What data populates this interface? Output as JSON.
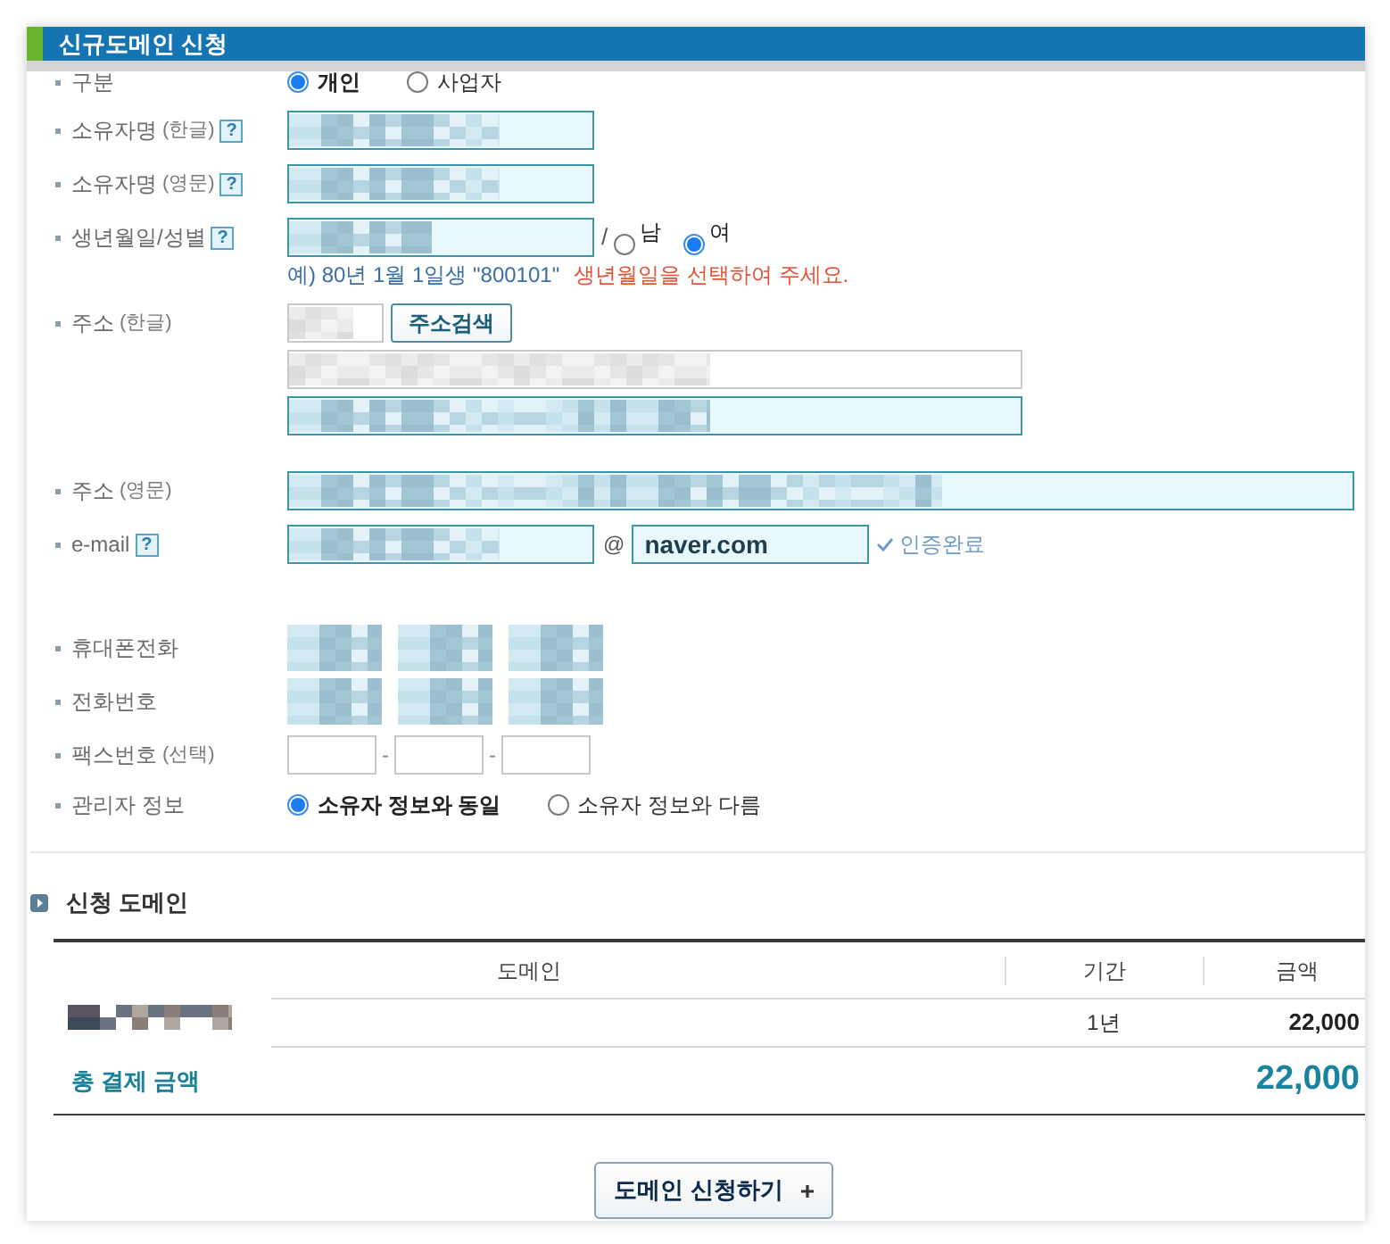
{
  "window": {
    "title": "신규도메인 신청"
  },
  "form": {
    "rows": [
      {
        "kind": "radio",
        "label": "구분",
        "options": [
          {
            "label": "개인",
            "selected": true
          },
          {
            "label": "사업자",
            "selected": false
          }
        ]
      },
      {
        "kind": "name",
        "label": "소유자명",
        "note": "(한글)",
        "help": "?",
        "field": {
          "redacted": true
        }
      },
      {
        "kind": "name",
        "label": "소유자명",
        "note": "(영문)",
        "help": "?",
        "field": {
          "redacted": true
        }
      },
      {
        "kind": "birth",
        "label": "생년월일/성별",
        "help": "?",
        "field": {
          "redacted": true
        },
        "separator": "/",
        "options": [
          {
            "label": "남",
            "selected": false
          },
          {
            "label": "여",
            "selected": true
          }
        ],
        "example": "예) 80년 1월 1일생 \"800101\"",
        "warning": "생년월일을 선택하여 주세요."
      },
      {
        "kind": "address_kr",
        "label": "주소",
        "note": "(한글)",
        "zip": {
          "redacted": true
        },
        "search_button": "주소검색",
        "lines": [
          {
            "redacted": true
          },
          {
            "redacted": true
          }
        ]
      },
      {
        "kind": "address_en",
        "label": "주소",
        "note": "(영문)",
        "field": {
          "redacted": true
        }
      },
      {
        "kind": "email",
        "label": "e-mail",
        "help": "?",
        "field": {
          "redacted": true
        },
        "at": "@",
        "domain": "naver.com",
        "verified": true,
        "verified_text": "인증완료"
      },
      {
        "kind": "phone",
        "label": "휴대폰전화",
        "fields": [
          {
            "redacted": true
          },
          {
            "redacted": true
          },
          {
            "redacted": true
          }
        ]
      },
      {
        "kind": "phone",
        "label": "전화번호",
        "fields": [
          {
            "redacted": true
          },
          {
            "redacted": true
          },
          {
            "redacted": true
          }
        ]
      },
      {
        "kind": "phone",
        "label": "팩스번호",
        "note": "(선택)",
        "fields": [
          {
            "redacted": false
          },
          {
            "redacted": false
          },
          {
            "redacted": false
          }
        ],
        "separators": [
          "-",
          "-"
        ]
      },
      {
        "kind": "radio",
        "label": "관리자 정보",
        "options": [
          {
            "label": "소유자 정보와 동일",
            "selected": true
          },
          {
            "label": "소유자 정보와 다름",
            "selected": false
          }
        ]
      }
    ]
  },
  "domain_section": {
    "title": "신청 도메인",
    "table": {
      "columns": [
        "도메인",
        "기간",
        "금액"
      ],
      "rows": [
        {
          "domain_redacted": true,
          "period": "1년",
          "amount": "22,000"
        }
      ],
      "total": {
        "label": "총 결제 금액",
        "amount": "22,000"
      }
    }
  },
  "submit": {
    "label": "도메인 신청하기"
  }
}
